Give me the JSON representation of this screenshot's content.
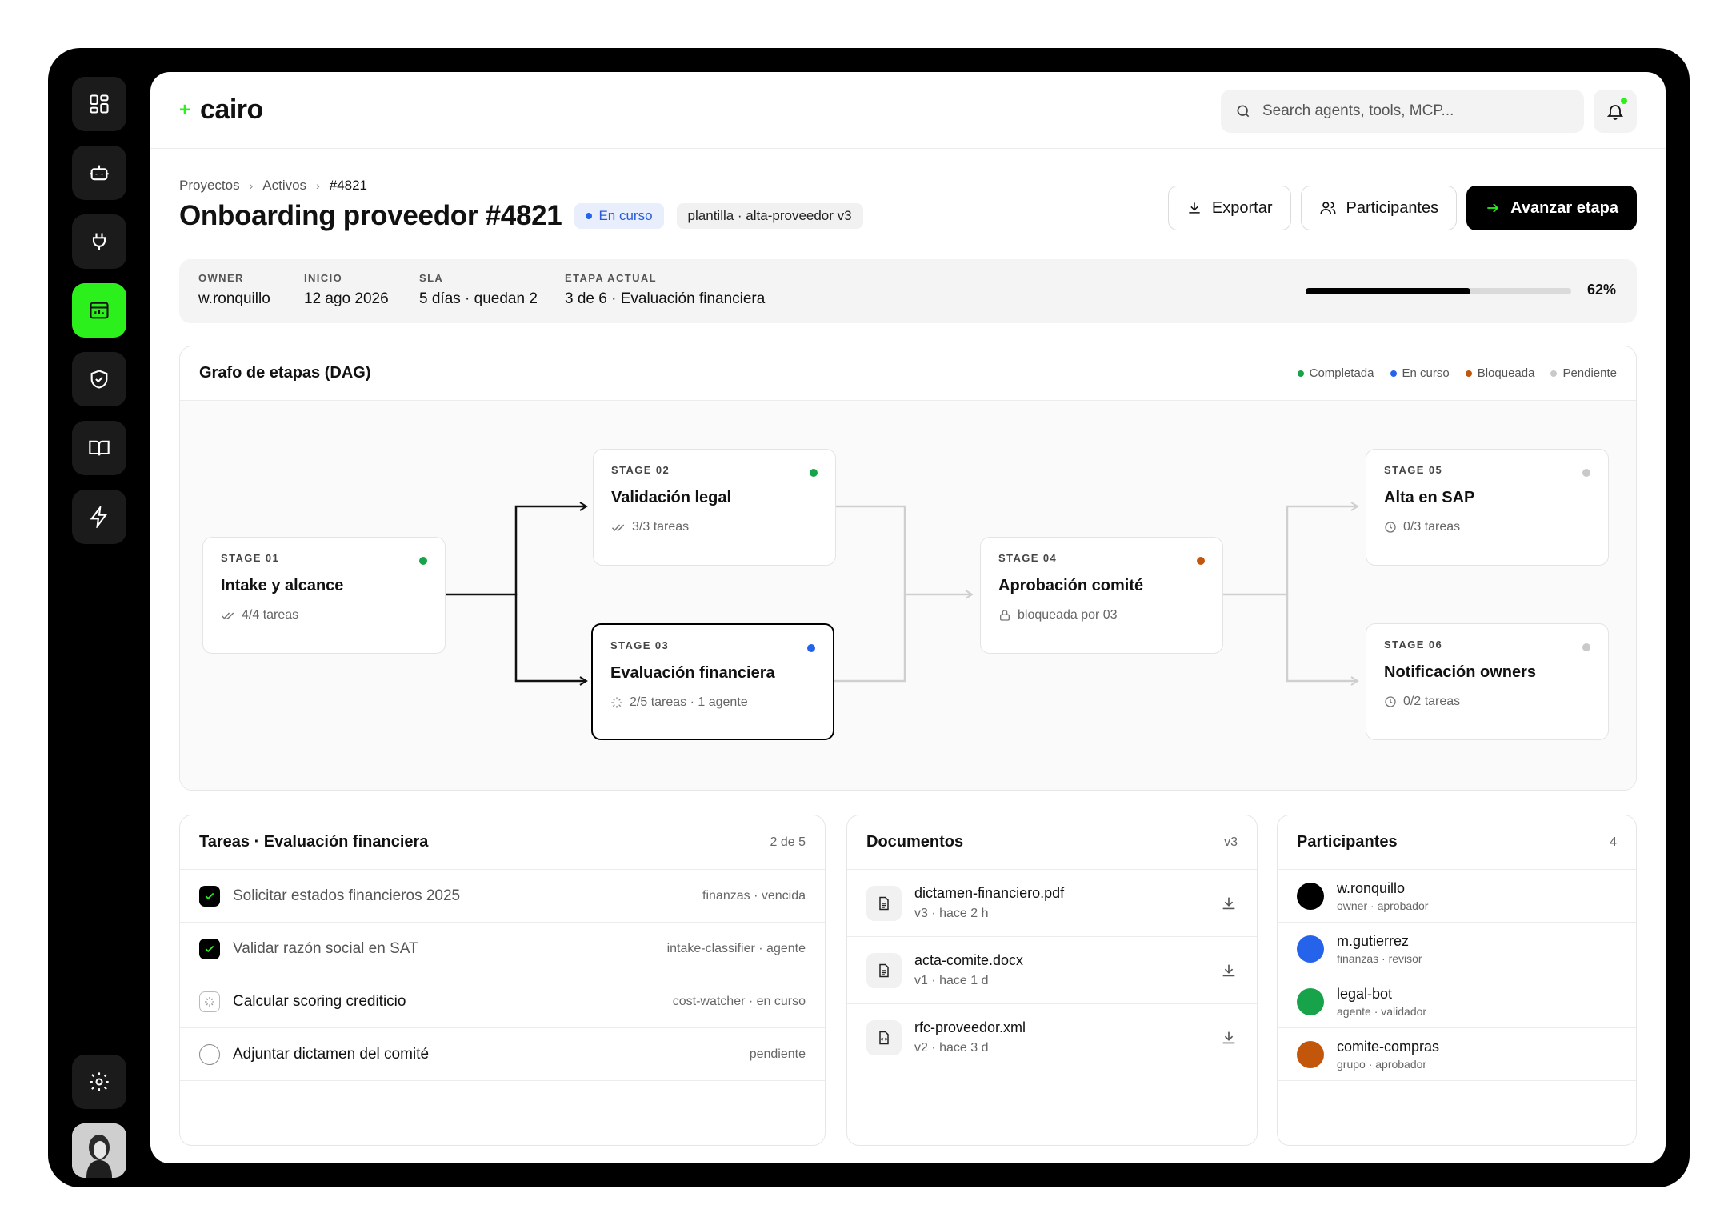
{
  "brand": {
    "name": "cairo",
    "accent": "#2cf01c"
  },
  "rail": {
    "items": [
      {
        "icon": "dashboard-icon"
      },
      {
        "icon": "robot-icon"
      },
      {
        "icon": "plug-icon"
      },
      {
        "icon": "workflow-icon",
        "active": true
      },
      {
        "icon": "shield-check-icon"
      },
      {
        "icon": "book-icon"
      },
      {
        "icon": "lightning-icon"
      }
    ],
    "settings_icon": "gear-icon",
    "avatar": "user-avatar"
  },
  "search": {
    "placeholder": "Search agents, tools, MCP..."
  },
  "breadcrumb": [
    "Proyectos",
    "Activos",
    "#4821"
  ],
  "page": {
    "title": "Onboarding proveedor #4821",
    "status": "En curso",
    "template": "plantilla · alta-proveedor v3"
  },
  "actions": {
    "export": "Exportar",
    "participants": "Participantes",
    "advance": "Avanzar etapa"
  },
  "meta": {
    "owner_label": "OWNER",
    "owner": "w.ronquillo",
    "start_label": "INICIO",
    "start": "12 ago 2026",
    "sla_label": "SLA",
    "sla": "5 días · quedan 2",
    "stage_label": "ETAPA ACTUAL",
    "stage": "3 de 6 · Evaluación financiera",
    "progress": 62,
    "progress_text": "62%"
  },
  "dag": {
    "title": "Grafo de etapas (DAG)",
    "legend": [
      {
        "label": "Completada",
        "color": "#16a34a"
      },
      {
        "label": "En curso",
        "color": "#2563eb"
      },
      {
        "label": "Bloqueada",
        "color": "#c2570c"
      },
      {
        "label": "Pendiente",
        "color": "#c9c9c9"
      }
    ],
    "stages": [
      {
        "label": "STAGE 01",
        "title": "Intake y alcance",
        "sub": "4/4 tareas",
        "status_color": "#16a34a",
        "icon": "double-check-icon"
      },
      {
        "label": "STAGE 02",
        "title": "Validación legal",
        "sub": "3/3 tareas",
        "status_color": "#16a34a",
        "icon": "double-check-icon"
      },
      {
        "label": "STAGE 03",
        "title": "Evaluación financiera",
        "sub": "2/5 tareas · 1 agente",
        "status_color": "#2563eb",
        "icon": "spinner-icon"
      },
      {
        "label": "STAGE 04",
        "title": "Aprobación comité",
        "sub": "bloqueada por 03",
        "status_color": "#c2570c",
        "icon": "lock-icon"
      },
      {
        "label": "STAGE 05",
        "title": "Alta en SAP",
        "sub": "0/3 tareas",
        "status_color": "#c9c9c9",
        "icon": "clock-icon"
      },
      {
        "label": "STAGE 06",
        "title": "Notificación owners",
        "sub": "0/2 tareas",
        "status_color": "#c9c9c9",
        "icon": "clock-icon"
      }
    ]
  },
  "tasks": {
    "title": "Tareas · Evaluación financiera",
    "count": "2 de 5",
    "items": [
      {
        "label": "Solicitar estados financieros 2025",
        "meta": "finanzas · vencida",
        "state": "done"
      },
      {
        "label": "Validar razón social en SAT",
        "meta": "intake-classifier · agente",
        "state": "done"
      },
      {
        "label": "Calcular scoring crediticio",
        "meta": "cost-watcher · en curso",
        "state": "progress"
      },
      {
        "label": "Adjuntar dictamen del comité",
        "meta": "pendiente",
        "state": "todo"
      }
    ]
  },
  "documents": {
    "title": "Documentos",
    "version": "v3",
    "items": [
      {
        "name": "dictamen-financiero.pdf",
        "meta": "v3 · hace 2 h"
      },
      {
        "name": "acta-comite.docx",
        "meta": "v1 · hace 1 d"
      },
      {
        "name": "rfc-proveedor.xml",
        "meta": "v2 · hace 3 d"
      }
    ]
  },
  "participants": {
    "title": "Participantes",
    "count": "4",
    "items": [
      {
        "name": "w.ronquillo",
        "role": "owner · aprobador",
        "color": "#000000"
      },
      {
        "name": "m.gutierrez",
        "role": "finanzas · revisor",
        "color": "#2563eb"
      },
      {
        "name": "legal-bot",
        "role": "agente · validador",
        "color": "#16a34a"
      },
      {
        "name": "comite-compras",
        "role": "grupo · aprobador",
        "color": "#c2570c"
      }
    ]
  }
}
